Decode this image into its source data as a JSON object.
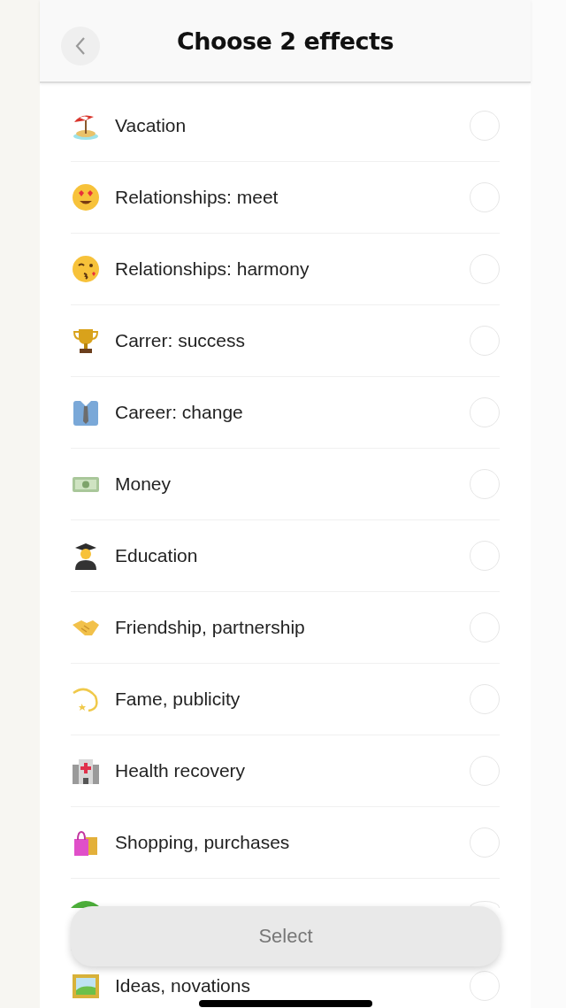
{
  "header": {
    "title": "Choose 2 effects"
  },
  "effects": [
    {
      "label": "Vacation",
      "selected": false
    },
    {
      "label": "Relationships: meet",
      "selected": false
    },
    {
      "label": "Relationships: harmony",
      "selected": false
    },
    {
      "label": "Carrer: success",
      "selected": false
    },
    {
      "label": "Career: change",
      "selected": false
    },
    {
      "label": "Money",
      "selected": false
    },
    {
      "label": "Education",
      "selected": false
    },
    {
      "label": "Friendship, partnership",
      "selected": false
    },
    {
      "label": "Fame, publicity",
      "selected": false
    },
    {
      "label": "Health recovery",
      "selected": false
    },
    {
      "label": "Shopping, purchases",
      "selected": false
    },
    {
      "selected": false
    },
    {
      "label": "Ideas, novations",
      "selected": false
    }
  ],
  "select_button": {
    "label": "Select",
    "disabled": true
  }
}
